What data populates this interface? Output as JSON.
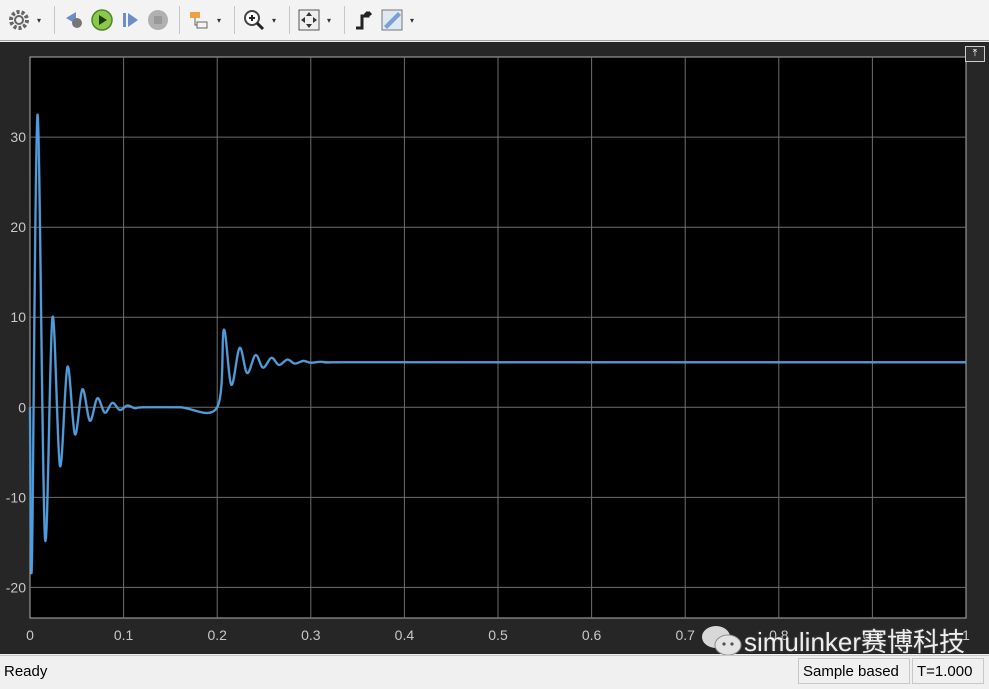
{
  "toolbar": {
    "buttons": [
      {
        "icon": "gear-icon",
        "dropdown": true
      },
      {
        "icon": "step-back-icon"
      },
      {
        "icon": "run-icon"
      },
      {
        "icon": "step-forward-icon"
      },
      {
        "icon": "stop-icon"
      },
      {
        "icon": "highlight-block-icon",
        "dropdown": true
      },
      {
        "icon": "zoom-in-icon",
        "dropdown": true
      },
      {
        "icon": "fit-to-view-icon",
        "dropdown": true
      },
      {
        "icon": "triggers-icon"
      },
      {
        "icon": "measurements-icon",
        "dropdown": true
      }
    ]
  },
  "status": {
    "ready": "Ready",
    "mode": "Sample based",
    "time": "T=1.000"
  },
  "watermark": "simulinker赛博科技",
  "colors": {
    "line": "#4a9de6",
    "plot_bg": "#000000",
    "panel_bg": "#262626",
    "grid": "#6e6e6e",
    "tick": "#c8c8c8"
  },
  "chart_data": {
    "type": "line",
    "title": "",
    "xlabel": "",
    "ylabel": "",
    "xlim": [
      0,
      1
    ],
    "ylim": [
      -23.4,
      38.9
    ],
    "xticks": [
      0,
      0.1,
      0.2,
      0.3,
      0.4,
      0.5,
      0.6,
      0.7,
      0.8,
      0.9,
      1
    ],
    "xtick_labels": [
      "0",
      "0.1",
      "0.2",
      "0.3",
      "0.4",
      "0.5",
      "0.6",
      "0.7",
      "0.8",
      "0.9",
      "1"
    ],
    "yticks": [
      -20,
      -10,
      0,
      10,
      20,
      30
    ],
    "ytick_labels": [
      "-20",
      "-10",
      "0",
      "10",
      "20",
      "30"
    ],
    "grid": true,
    "series": [
      {
        "x": [
          0,
          0.002,
          0.008,
          0.016,
          0.024,
          0.032,
          0.04,
          0.048,
          0.056,
          0.064,
          0.072,
          0.08,
          0.088,
          0.096,
          0.104,
          0.112,
          0.12,
          0.16,
          0.2,
          0.207,
          0.215,
          0.224,
          0.232,
          0.241,
          0.249,
          0.258,
          0.266,
          0.275,
          0.283,
          0.292,
          0.3,
          0.31,
          0.32,
          0.33,
          0.5,
          1
        ],
        "y": [
          0,
          -17.5,
          32.5,
          -14.5,
          10,
          -6.5,
          4.5,
          -3,
          2,
          -1.5,
          1,
          -0.6,
          0.5,
          -0.3,
          0.2,
          -0.1,
          0,
          0,
          0,
          8.6,
          2.5,
          6.6,
          3.8,
          5.8,
          4.4,
          5.5,
          4.7,
          5.3,
          4.85,
          5.15,
          4.95,
          5.05,
          4.98,
          5,
          5,
          5
        ]
      }
    ]
  }
}
